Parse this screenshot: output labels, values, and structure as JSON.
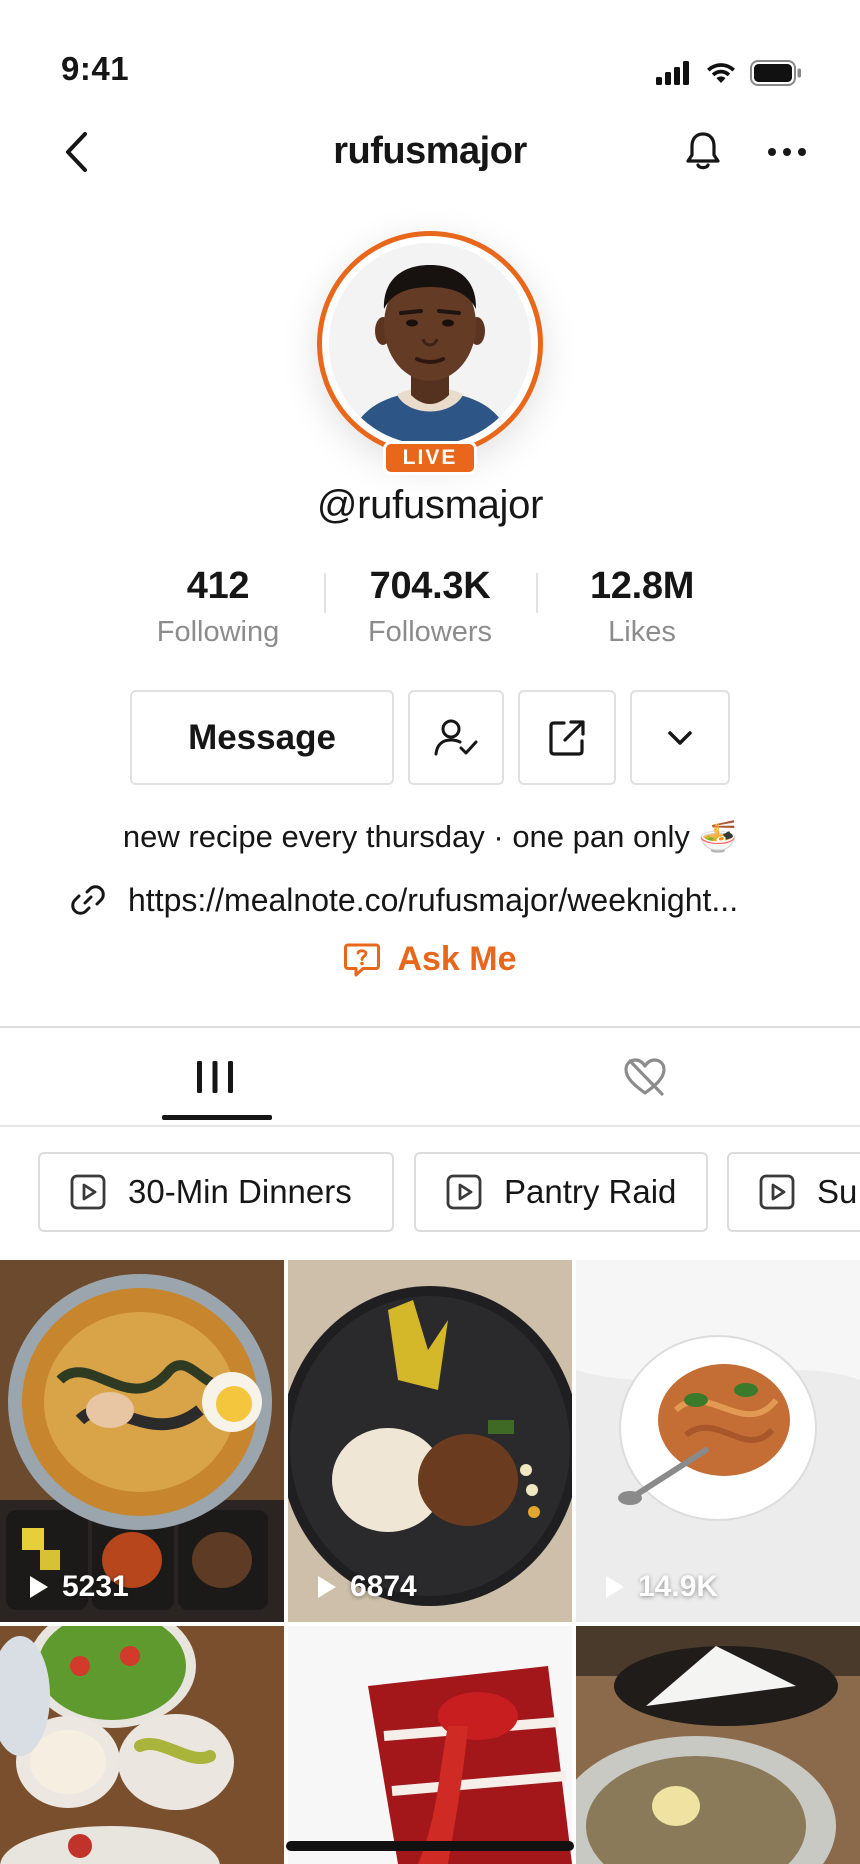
{
  "status_bar": {
    "time": "9:41"
  },
  "nav": {
    "title": "rufusmajor"
  },
  "profile": {
    "live_badge": "LIVE",
    "handle": "@rufusmajor",
    "stats": [
      {
        "value": "412",
        "label": "Following"
      },
      {
        "value": "704.3K",
        "label": "Followers"
      },
      {
        "value": "12.8M",
        "label": "Likes"
      }
    ],
    "message_label": "Message",
    "bio": "new recipe every thursday · one pan only 🍜",
    "link": "https://mealnote.co/rufusmajor/weeknight...",
    "ask_label": "Ask Me"
  },
  "playlists": [
    {
      "label": "30-Min Dinners"
    },
    {
      "label": "Pantry Raid"
    },
    {
      "label": "Su"
    }
  ],
  "videos": [
    {
      "views": "5231"
    },
    {
      "views": "6874"
    },
    {
      "views": "14.9K"
    }
  ],
  "colors": {
    "accent": "#e8671b",
    "text": "#161616",
    "muted": "#8c8c8c"
  }
}
